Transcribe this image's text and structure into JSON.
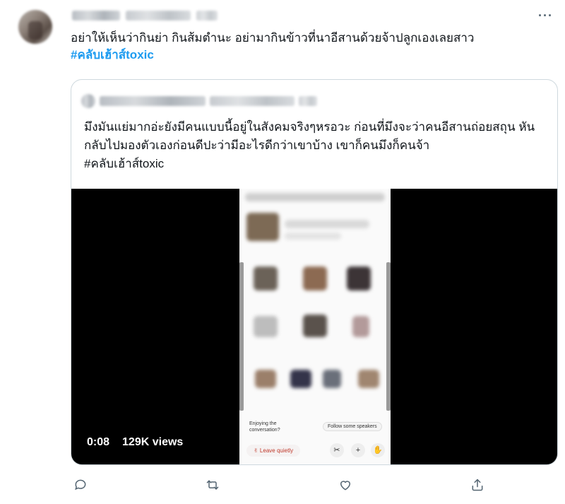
{
  "tweet": {
    "text": "อย่าให้เห็นว่ากินย่า กินส้มตำนะ อย่ามากินข้าวที่นาอีสานด้วยจ้าปลูกเองเลยสาว",
    "hashtag": "#คลับเฮ้าส์toxic",
    "more_label": "···"
  },
  "quote": {
    "text": "มึงมันแย่มากอ่ะยังมีคนแบบนี้อยู่ในสังคมจริงๆหรอวะ ก่อนที่มึงจะว่าคนอีสานถ่อยสถุน หันกลับไปมองตัวเองก่อนดีปะว่ามีอะไรดีกว่าเขาบ้าง เขาก็คนมึงก็คนจ้า",
    "hashtag": "#คลับเฮ้าส์toxic"
  },
  "video": {
    "time": "0:08",
    "views": "129K views",
    "phone": {
      "prompt": "Enjoying the conversation?",
      "follow": "Follow some speakers",
      "leave": "✌ Leave quietly",
      "scissors": "✂",
      "plus": "+",
      "hand": "✋"
    }
  },
  "actions": {
    "reply": "reply-icon",
    "retweet": "retweet-icon",
    "like": "heart-icon",
    "share": "share-icon"
  },
  "colors": {
    "accent": "#1d9bf0",
    "text": "#0f1419",
    "muted": "#536471",
    "border": "#cfd9de"
  }
}
